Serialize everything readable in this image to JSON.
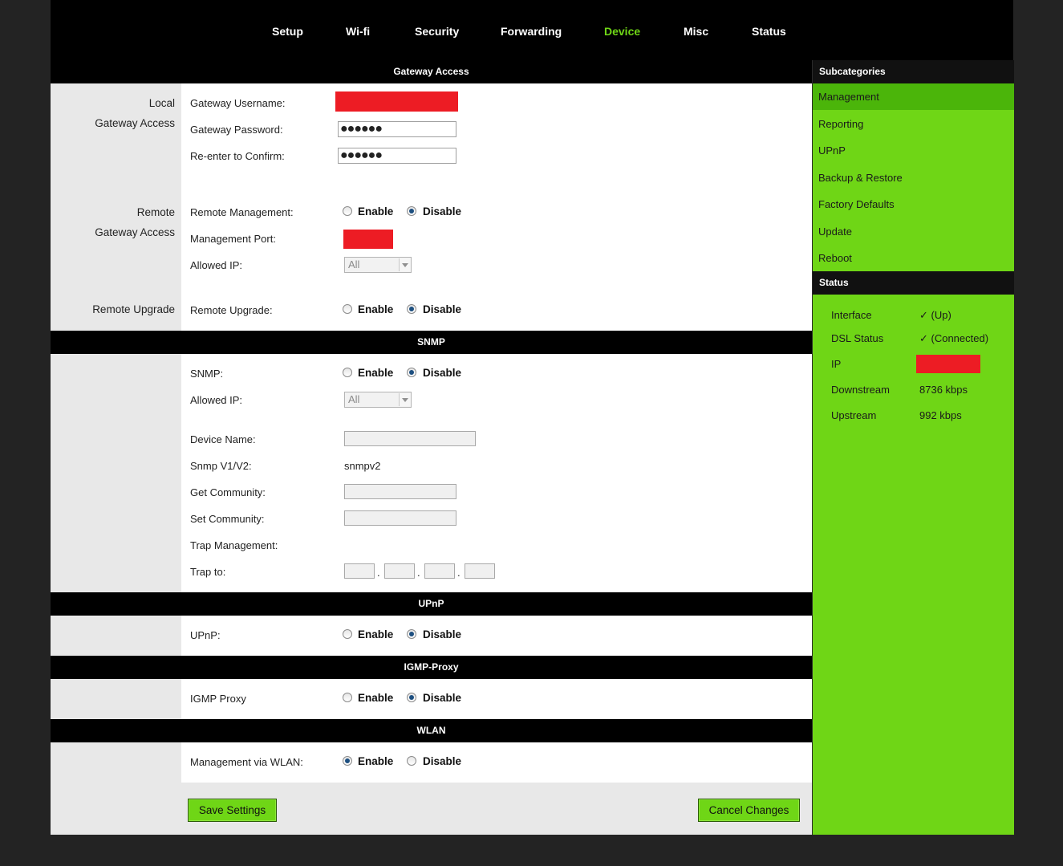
{
  "nav": [
    "Setup",
    "Wi-fi",
    "Security",
    "Forwarding",
    "Device",
    "Misc",
    "Status"
  ],
  "nav_active": "Device",
  "colors": {
    "accent": "#6fd616",
    "accent_dark": "#4bb50a",
    "header": "#000000",
    "redaction": "#ed1c24"
  },
  "sections": {
    "gateway_access": "Gateway Access",
    "snmp": "SNMP",
    "upnp": "UPnP",
    "igmp": "IGMP-Proxy",
    "wlan": "WLAN"
  },
  "gateway": {
    "local_label_1": "Local",
    "local_label_2": "Gateway Access",
    "username_label": "Gateway Username:",
    "password_label": "Gateway Password:",
    "password_value": "●●●●●●",
    "confirm_label": "Re-enter to Confirm:",
    "confirm_value": "●●●●●●",
    "remote_label_1": "Remote",
    "remote_label_2": "Gateway Access",
    "remote_mgmt_label": "Remote Management:",
    "mgmt_port_label": "Management Port:",
    "allowed_ip_label": "Allowed IP:",
    "allowed_ip_value": "All",
    "upgrade_group_label": "Remote Upgrade",
    "upgrade_label": "Remote Upgrade:"
  },
  "radio": {
    "enable": "Enable",
    "disable": "Disable"
  },
  "snmp": {
    "snmp_label": "SNMP:",
    "allowed_ip_label": "Allowed IP:",
    "allowed_ip_value": "All",
    "device_name_label": "Device Name:",
    "version_label": "Snmp V1/V2:",
    "version_value": "snmpv2",
    "get_label": "Get Community:",
    "set_label": "Set Community:",
    "trap_mgmt_label": "Trap Management:",
    "trap_to_label": "Trap to:",
    "dot": "."
  },
  "upnp": {
    "label": "UPnP:"
  },
  "igmp": {
    "label": "IGMP Proxy"
  },
  "wlan": {
    "label": "Management via WLAN:"
  },
  "buttons": {
    "save": "Save Settings",
    "cancel": "Cancel Changes"
  },
  "sidebar": {
    "subcategories_title": "Subcategories",
    "items": [
      "Management",
      "Reporting",
      "UPnP",
      "Backup & Restore",
      "Factory Defaults",
      "Update",
      "Reboot"
    ],
    "status_title": "Status",
    "status": [
      {
        "label": "Interface",
        "value": "✓ (Up)"
      },
      {
        "label": "DSL Status",
        "value": "✓ (Connected)"
      },
      {
        "label": "IP",
        "value": ""
      },
      {
        "label": "Downstream",
        "value": "8736 kbps"
      },
      {
        "label": "Upstream",
        "value": "992 kbps"
      }
    ]
  }
}
